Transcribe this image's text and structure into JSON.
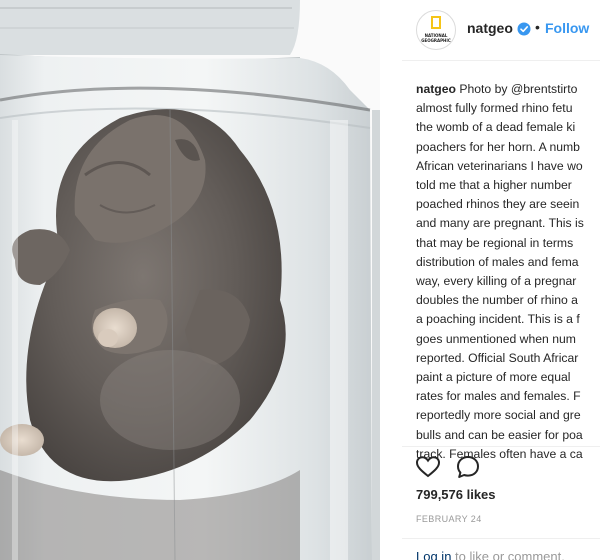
{
  "post": {
    "username": "natgeo",
    "separator": "•",
    "follow_label": "Follow",
    "caption_username": "natgeo",
    "caption_text": "Photo by @brentstirto\nalmost fully formed rhino fetu\nthe womb of a dead female ki\npoachers for her horn. A numb\nAfrican veterinarians I have wo\ntold me that a higher number \npoached rhinos they are seein\nand many are pregnant. This is\nthat may be regional in terms \ndistribution of males and fema\nway, every killing of a pregnar\ndoubles the number of rhino a\na poaching incident. This is a f\ngoes unmentioned when num\nreported. Official South Africar\npaint a picture of more equal \nrates for males and females. F\nreportedly more social and gre\nbulls and can be easier for poa\ntrack. Females often have a ca",
    "likes": "799,576 likes",
    "date": "FEBRUARY 24",
    "login_link": "Log in",
    "login_rest": " to like or comment."
  },
  "avatar": {
    "logo_line1": "NATIONAL",
    "logo_line2": "GEOGRAPHIC",
    "logo_color": "#f5c518"
  },
  "colors": {
    "link": "#3897f0",
    "verified": "#3897f0",
    "muted": "#999999"
  },
  "icons": {
    "verified": "verified-badge-icon",
    "like": "heart-icon",
    "comment": "comment-icon"
  }
}
